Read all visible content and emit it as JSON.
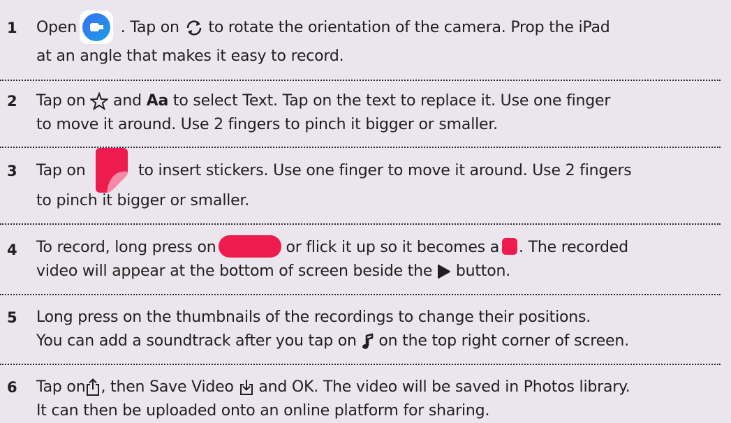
{
  "accent_color": "#ee1c4e",
  "steps": [
    {
      "number": "1",
      "line1_a": "Open",
      "line1_b": ". Tap on",
      "line1_c": "to rotate the orientation of the camera. Prop the iPad",
      "line2": "at an angle that makes it easy to record.",
      "icons": [
        "camera-app-icon",
        "rotate-camera-icon"
      ]
    },
    {
      "number": "2",
      "line1_a": "Tap on",
      "line1_b": "and",
      "line1_aa": "Aa",
      "line1_c": "to select Text. Tap on the text to replace it. Use one finger",
      "line2": "to move it around. Use 2 fingers to pinch it bigger or smaller.",
      "icons": [
        "star-icon"
      ]
    },
    {
      "number": "3",
      "line1_a": "Tap on",
      "line1_c": "to insert stickers. Use one finger to move it around. Use 2 fingers",
      "line2": "to pinch it bigger or smaller.",
      "icons": [
        "sticker-icon"
      ]
    },
    {
      "number": "4",
      "line1_a": "To record, long press on",
      "line1_b": "or flick it up so it becomes a",
      "line1_c": ". The recorded",
      "line2_a": "video will appear at the bottom of screen beside the",
      "line2_b": "button.",
      "icons": [
        "record-pill-icon",
        "stop-square-icon",
        "play-icon"
      ]
    },
    {
      "number": "5",
      "line1": "Long press on the thumbnails of the recordings to change their positions.",
      "line2_a": "You can add a soundtrack after you tap on",
      "line2_b": "on the top right corner of screen.",
      "icons": [
        "music-note-icon"
      ]
    },
    {
      "number": "6",
      "line1_a": "Tap on",
      "line1_b": ", then Save Video",
      "line1_c": "and OK.  The video will be saved in Photos library.",
      "line2": "It can then be uploaded onto an online platform for sharing.",
      "icons": [
        "share-icon",
        "save-video-icon"
      ]
    }
  ]
}
